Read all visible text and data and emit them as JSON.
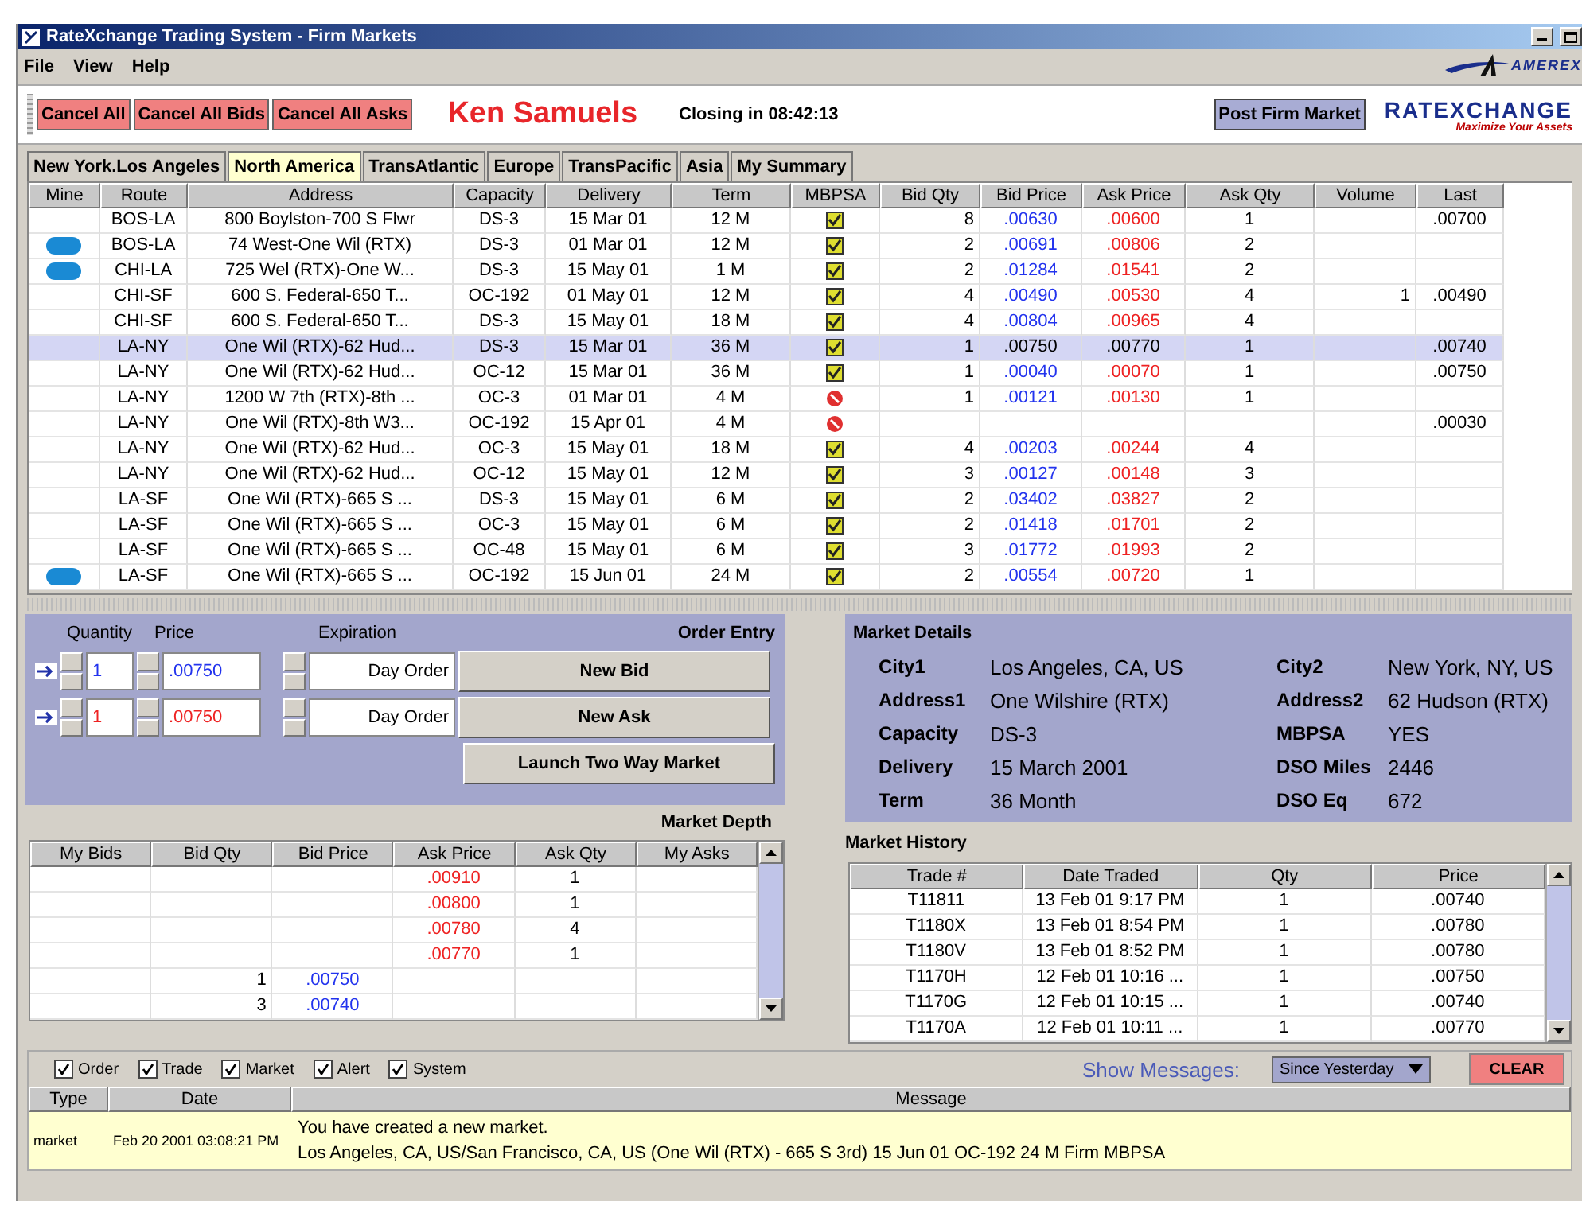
{
  "window": {
    "title": "RateXchange Trading System - Firm Markets"
  },
  "menu": [
    "File",
    "View",
    "Help"
  ],
  "toolbar": {
    "buttons": [
      "Cancel All",
      "Cancel All Bids",
      "Cancel All Asks"
    ],
    "user": "Ken Samuels",
    "closing": "Closing in 08:42:13",
    "post_button": "Post Firm Market"
  },
  "logos": {
    "amerex": "AMEREX",
    "ratexchange": "RATEXCHANGE",
    "tagline": "Maximize Your Assets"
  },
  "tabs": [
    {
      "label": "New York.Los Angeles",
      "selected": false
    },
    {
      "label": "North America",
      "selected": true
    },
    {
      "label": "TransAtlantic",
      "selected": false
    },
    {
      "label": "Europe",
      "selected": false
    },
    {
      "label": "TransPacific",
      "selected": false
    },
    {
      "label": "Asia",
      "selected": false
    },
    {
      "label": "My Summary",
      "selected": false
    }
  ],
  "markets": {
    "columns": [
      "Mine",
      "Route",
      "Address",
      "Capacity",
      "Delivery",
      "Term",
      "MBPSA",
      "Bid Qty",
      "Bid Price",
      "Ask Price",
      "Ask Qty",
      "Volume",
      "Last"
    ],
    "rows": [
      {
        "mine": false,
        "selected": false,
        "route": "BOS-LA",
        "address": "800 Boylston-700 S Flwr",
        "capacity": "DS-3",
        "delivery": "15 Mar 01",
        "term": "12 M",
        "mbpsa": true,
        "bid_qty": "8",
        "bid_price": ".00630",
        "ask_price": ".00600",
        "ask_qty": "1",
        "last": ".00700"
      },
      {
        "mine": true,
        "selected": false,
        "route": "BOS-LA",
        "address": "74 West-One Wil (RTX)",
        "capacity": "DS-3",
        "delivery": "01 Mar 01",
        "term": "12 M",
        "mbpsa": true,
        "bid_qty": "2",
        "bid_price": ".00691",
        "ask_price": ".00806",
        "ask_qty": "2"
      },
      {
        "mine": true,
        "selected": false,
        "route": "CHI-LA",
        "address": "725 Wel (RTX)-One W...",
        "capacity": "DS-3",
        "delivery": "15 May 01",
        "term": "1 M",
        "mbpsa": true,
        "bid_qty": "2",
        "bid_price": ".01284",
        "ask_price": ".01541",
        "ask_qty": "2"
      },
      {
        "mine": false,
        "selected": false,
        "route": "CHI-SF",
        "address": "600 S. Federal-650 T...",
        "capacity": "OC-192",
        "delivery": "01 May 01",
        "term": "12 M",
        "mbpsa": true,
        "bid_qty": "4",
        "bid_price": ".00490",
        "ask_price": ".00530",
        "ask_qty": "4",
        "volume": "1",
        "last": ".00490"
      },
      {
        "mine": false,
        "selected": false,
        "route": "CHI-SF",
        "address": "600 S. Federal-650 T...",
        "capacity": "DS-3",
        "delivery": "15 May 01",
        "term": "18 M",
        "mbpsa": true,
        "bid_qty": "4",
        "bid_price": ".00804",
        "ask_price": ".00965",
        "ask_qty": "4"
      },
      {
        "mine": false,
        "selected": true,
        "route": "LA-NY",
        "address": "One Wil (RTX)-62 Hud...",
        "capacity": "DS-3",
        "delivery": "15 Mar 01",
        "term": "36 M",
        "mbpsa": true,
        "bid_qty": "1",
        "bid_price": ".00750",
        "ask_price": ".00770",
        "ask_qty": "1",
        "last": ".00740"
      },
      {
        "mine": false,
        "selected": false,
        "route": "LA-NY",
        "address": "One Wil (RTX)-62 Hud...",
        "capacity": "OC-12",
        "delivery": "15 Mar 01",
        "term": "36 M",
        "mbpsa": true,
        "bid_qty": "1",
        "bid_price": ".00040",
        "ask_price": ".00070",
        "ask_qty": "1",
        "last": ".00750"
      },
      {
        "mine": false,
        "selected": false,
        "route": "LA-NY",
        "address": "1200 W 7th (RTX)-8th ...",
        "capacity": "OC-3",
        "delivery": "01 Mar 01",
        "term": "4 M",
        "mbpsa": false,
        "bid_qty": "1",
        "bid_price": ".00121",
        "ask_price": ".00130",
        "ask_qty": "1"
      },
      {
        "mine": false,
        "selected": false,
        "route": "LA-NY",
        "address": "One Wil (RTX)-8th W3...",
        "capacity": "OC-192",
        "delivery": "15 Apr 01",
        "term": "4 M",
        "mbpsa": false,
        "last": ".00030"
      },
      {
        "mine": false,
        "selected": false,
        "route": "LA-NY",
        "address": "One Wil (RTX)-62 Hud...",
        "capacity": "OC-3",
        "delivery": "15 May 01",
        "term": "18 M",
        "mbpsa": true,
        "bid_qty": "4",
        "bid_price": ".00203",
        "ask_price": ".00244",
        "ask_qty": "4"
      },
      {
        "mine": false,
        "selected": false,
        "route": "LA-NY",
        "address": "One Wil (RTX)-62 Hud...",
        "capacity": "OC-12",
        "delivery": "15 May 01",
        "term": "12 M",
        "mbpsa": true,
        "bid_qty": "3",
        "bid_price": ".00127",
        "ask_price": ".00148",
        "ask_qty": "3"
      },
      {
        "mine": false,
        "selected": false,
        "route": "LA-SF",
        "address": "One Wil (RTX)-665 S ...",
        "capacity": "DS-3",
        "delivery": "15 May 01",
        "term": "6 M",
        "mbpsa": true,
        "bid_qty": "2",
        "bid_price": ".03402",
        "ask_price": ".03827",
        "ask_qty": "2"
      },
      {
        "mine": false,
        "selected": false,
        "route": "LA-SF",
        "address": "One Wil (RTX)-665 S ...",
        "capacity": "OC-3",
        "delivery": "15 May 01",
        "term": "6 M",
        "mbpsa": true,
        "bid_qty": "2",
        "bid_price": ".01418",
        "ask_price": ".01701",
        "ask_qty": "2"
      },
      {
        "mine": false,
        "selected": false,
        "route": "LA-SF",
        "address": "One Wil (RTX)-665 S ...",
        "capacity": "OC-48",
        "delivery": "15 May 01",
        "term": "6 M",
        "mbpsa": true,
        "bid_qty": "3",
        "bid_price": ".01772",
        "ask_price": ".01993",
        "ask_qty": "2"
      },
      {
        "mine": true,
        "selected": false,
        "route": "LA-SF",
        "address": "One Wil (RTX)-665 S ...",
        "capacity": "OC-192",
        "delivery": "15 Jun 01",
        "term": "24 M",
        "mbpsa": true,
        "bid_qty": "2",
        "bid_price": ".00554",
        "ask_price": ".00720",
        "ask_qty": "1"
      }
    ]
  },
  "order_entry": {
    "title": "Order Entry",
    "labels": [
      "Quantity",
      "Price",
      "Expiration"
    ],
    "orders": [
      {
        "kind": "bid",
        "quantity": "1",
        "price": ".00750",
        "expiration": "Day Order",
        "button": "New Bid"
      },
      {
        "kind": "ask",
        "quantity": "1",
        "price": ".00750",
        "expiration": "Day Order",
        "button": "New Ask"
      }
    ],
    "launch_button": "Launch Two Way Market"
  },
  "market_depth": {
    "title": "Market Depth",
    "columns": [
      "My Bids",
      "Bid Qty",
      "Bid Price",
      "Ask Price",
      "Ask Qty",
      "My Asks"
    ],
    "rows": [
      {
        "ask_price": ".00910",
        "ask_qty": "1"
      },
      {
        "ask_price": ".00800",
        "ask_qty": "1"
      },
      {
        "ask_price": ".00780",
        "ask_qty": "4"
      },
      {
        "ask_price": ".00770",
        "ask_qty": "1"
      },
      {
        "bid_qty": "1",
        "bid_price": ".00750"
      },
      {
        "bid_qty": "3",
        "bid_price": ".00740"
      }
    ]
  },
  "market_details": {
    "title": "Market Details",
    "left": [
      {
        "label": "City1",
        "value": "Los Angeles, CA, US"
      },
      {
        "label": "Address1",
        "value": "One Wilshire (RTX)"
      },
      {
        "label": "Capacity",
        "value": "DS-3"
      },
      {
        "label": "Delivery",
        "value": "15 March 2001"
      },
      {
        "label": "Term",
        "value": "36 Month"
      }
    ],
    "right": [
      {
        "label": "City2",
        "value": "New York, NY, US"
      },
      {
        "label": "Address2",
        "value": "62 Hudson (RTX)"
      },
      {
        "label": "MBPSA",
        "value": "YES"
      },
      {
        "label": "DSO Miles",
        "value": "2446"
      },
      {
        "label": "DSO Eq",
        "value": "672"
      }
    ]
  },
  "market_history": {
    "title": "Market History",
    "columns": [
      "Trade #",
      "Date Traded",
      "Qty",
      "Price"
    ],
    "rows": [
      [
        "T11811",
        "13 Feb 01 9:17 PM",
        "1",
        ".00740"
      ],
      [
        "T1180X",
        "13 Feb 01 8:54 PM",
        "1",
        ".00780"
      ],
      [
        "T1180V",
        "13 Feb 01 8:52 PM",
        "1",
        ".00780"
      ],
      [
        "T1170H",
        "12 Feb 01 10:16 ...",
        "1",
        ".00750"
      ],
      [
        "T1170G",
        "12 Feb 01 10:15 ...",
        "1",
        ".00740"
      ],
      [
        "T1170A",
        "12 Feb 01 10:11 ...",
        "1",
        ".00770"
      ]
    ]
  },
  "messages": {
    "filters": [
      {
        "label": "Order",
        "checked": true
      },
      {
        "label": "Trade",
        "checked": true
      },
      {
        "label": "Market",
        "checked": true
      },
      {
        "label": "Alert",
        "checked": true
      },
      {
        "label": "System",
        "checked": true
      }
    ],
    "show_label": "Show Messages:",
    "show_value": "Since Yesterday",
    "clear_button": "CLEAR",
    "columns": [
      "Type",
      "Date",
      "Message"
    ],
    "rows": [
      {
        "type": "market",
        "date": "Feb 20 2001 03:08:21 PM",
        "lines": [
          "You have created a new market.",
          "Los Angeles, CA, US/San Francisco, CA, US (One Wil (RTX) - 665 S 3rd) 15 Jun 01 OC-192 24 M Firm MBPSA"
        ]
      }
    ]
  }
}
